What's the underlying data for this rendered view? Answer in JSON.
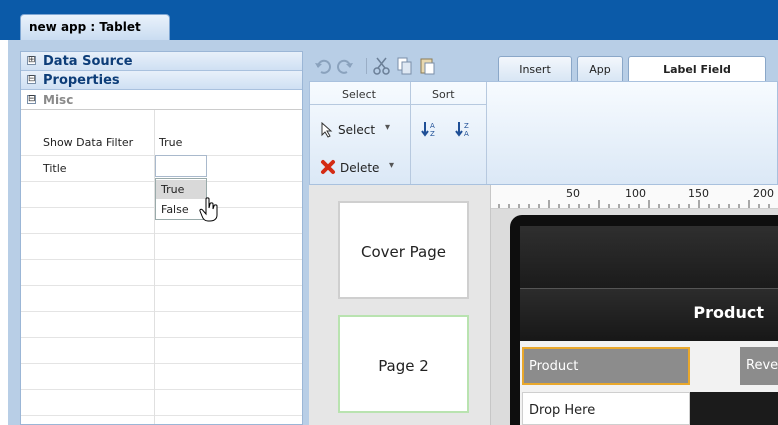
{
  "window": {
    "doc_tab_title": "new app : Tablet"
  },
  "left_panel": {
    "sections": [
      {
        "label": "Data Source",
        "expander": "⊞"
      },
      {
        "label": "Properties",
        "expander": "⊟"
      }
    ],
    "misc": {
      "label": "Misc",
      "expander": "⊟"
    },
    "properties": [
      {
        "key": "Show Data Filter",
        "value": "True"
      },
      {
        "key": "Title",
        "value": ""
      }
    ],
    "dropdown_options": [
      "True",
      "False"
    ]
  },
  "toolbar": {
    "icons": [
      "undo-icon",
      "redo-icon",
      "cut-icon",
      "copy-icon",
      "paste-icon"
    ]
  },
  "tabs": [
    {
      "label": "Insert"
    },
    {
      "label": "App"
    },
    {
      "label": "Label Field",
      "active": true
    }
  ],
  "ribbon": {
    "group_select": {
      "title": "Select",
      "select_btn": "Select",
      "delete_btn": "Delete"
    },
    "group_sort": {
      "title": "Sort"
    }
  },
  "pages": [
    {
      "label": "Cover Page"
    },
    {
      "label": "Page 2"
    }
  ],
  "ruler": {
    "ticks": [
      "50",
      "100",
      "150",
      "200"
    ]
  },
  "device": {
    "header_title": "Product",
    "field_product": "Product",
    "field_revenue": "Reve",
    "drop_here": "Drop Here"
  },
  "colors": {
    "accent_blue": "#0b5aa8",
    "selection_orange": "#e9a82c",
    "page_active_border": "#b9e3b0"
  }
}
